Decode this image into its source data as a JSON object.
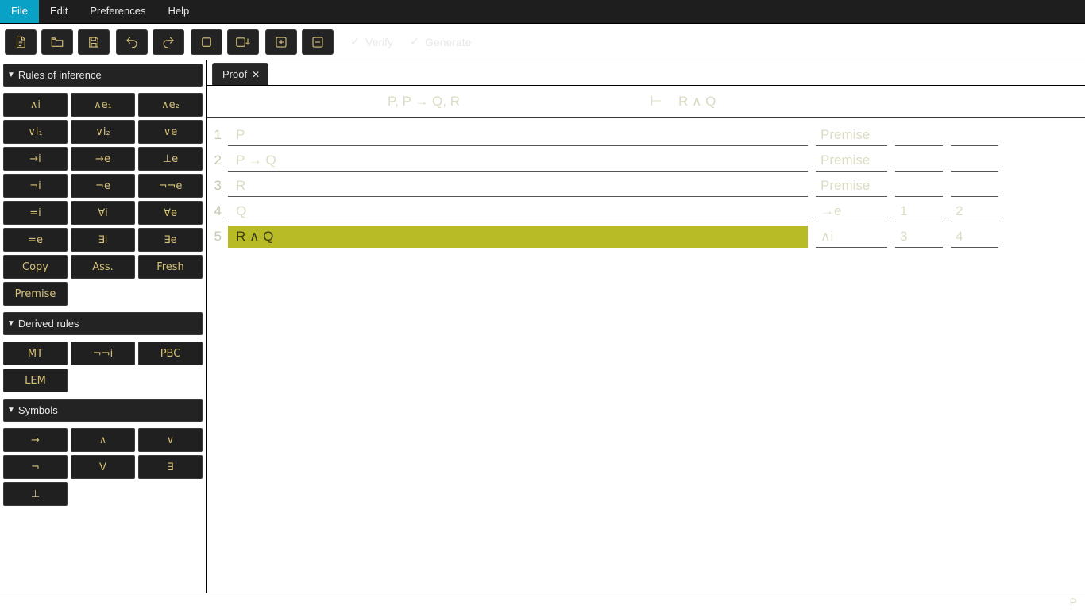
{
  "menu": {
    "items": [
      "File",
      "Edit",
      "Preferences",
      "Help"
    ],
    "active_index": 0
  },
  "toolbar": {
    "verify_label": "Verify",
    "generate_label": "Generate"
  },
  "sidebar": {
    "sections": [
      {
        "title": "Rules of inference",
        "buttons": [
          "∧i",
          "∧e₁",
          "∧e₂",
          "∨i₁",
          "∨i₂",
          "∨e",
          "→i",
          "→e",
          "⊥e",
          "¬i",
          "¬e",
          "¬¬e",
          "=i",
          "∀i",
          "∀e",
          "=e",
          "∃i",
          "∃e",
          "Copy",
          "Ass.",
          "Fresh",
          "Premise"
        ]
      },
      {
        "title": "Derived rules",
        "buttons": [
          "MT",
          "¬¬i",
          "PBC",
          "LEM"
        ]
      },
      {
        "title": "Symbols",
        "buttons": [
          "→",
          "∧",
          "∨",
          "¬",
          "∀",
          "∃",
          "⊥"
        ]
      }
    ]
  },
  "tab": {
    "label": "Proof"
  },
  "sequent": {
    "left": "P, P → Q, R",
    "turnstile": "⊢",
    "right": "R ∧ Q"
  },
  "proof": {
    "lines": [
      {
        "n": "1",
        "formula": "P",
        "rule": "Premise",
        "r1": "",
        "r2": "",
        "hl": false
      },
      {
        "n": "2",
        "formula": "P → Q",
        "rule": "Premise",
        "r1": "",
        "r2": "",
        "hl": false
      },
      {
        "n": "3",
        "formula": "R",
        "rule": "Premise",
        "r1": "",
        "r2": "",
        "hl": false
      },
      {
        "n": "4",
        "formula": "Q",
        "rule": "→e",
        "r1": "1",
        "r2": "2",
        "hl": false
      },
      {
        "n": "5",
        "formula": "R ∧ Q",
        "rule": "∧i",
        "r1": "3",
        "r2": "4",
        "hl": true
      }
    ]
  },
  "status": {
    "text": "P"
  }
}
